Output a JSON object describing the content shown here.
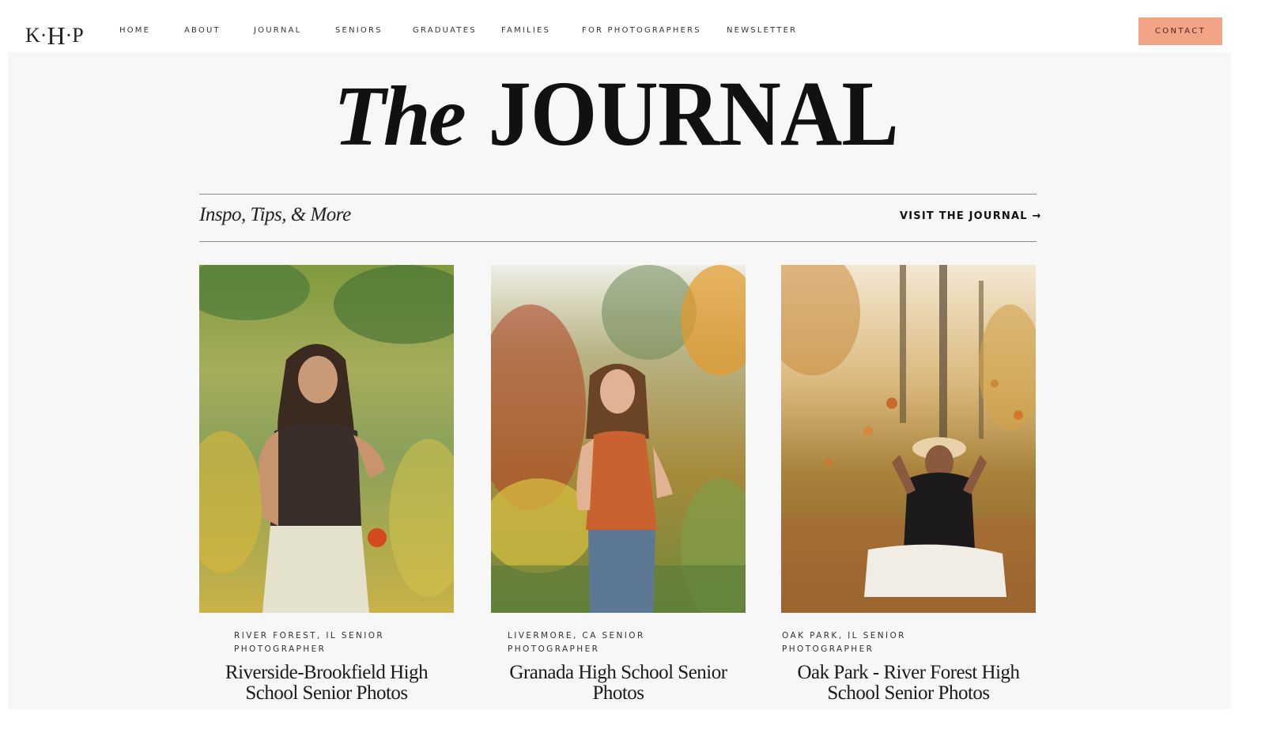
{
  "header": {
    "logo": {
      "left": "K",
      "dot1": "·",
      "middle": "H",
      "dot2": "·",
      "right": "P"
    },
    "nav": [
      {
        "label": "HOME"
      },
      {
        "label": "ABOUT"
      },
      {
        "label": "JOURNAL"
      },
      {
        "label": "SENIORS"
      },
      {
        "label": "GRADUATES"
      },
      {
        "label": "FAMILIES"
      },
      {
        "label": "FOR PHOTOGRAPHERS"
      },
      {
        "label": "NEWSLETTER"
      }
    ],
    "contact_label": "CONTACT",
    "contact_color": "#f3a487"
  },
  "hero": {
    "title_italic": "The",
    "title_caps": "JOURNAL"
  },
  "section": {
    "subtitle": "Inspo, Tips, & More",
    "visit_label": "VISIT THE JOURNAL →"
  },
  "posts": [
    {
      "category": "RIVER FOREST, IL SENIOR PHOTOGRAPHER",
      "title": "Riverside-Brookfield High School Senior Photos",
      "image_alt": "Senior girl in brown top holding autumn leaves in a green and yellow field"
    },
    {
      "category": "LIVERMORE, CA SENIOR PHOTOGRAPHER",
      "title": "Granada High School Senior Photos",
      "image_alt": "Senior girl in orange tank top standing in an autumn vineyard"
    },
    {
      "category": "OAK PARK, IL SENIOR PHOTOGRAPHER",
      "title": "Oak Park - River Forest High School Senior Photos",
      "image_alt": "Senior girl in hat sitting on leaves tossing autumn leaves into the air"
    }
  ]
}
